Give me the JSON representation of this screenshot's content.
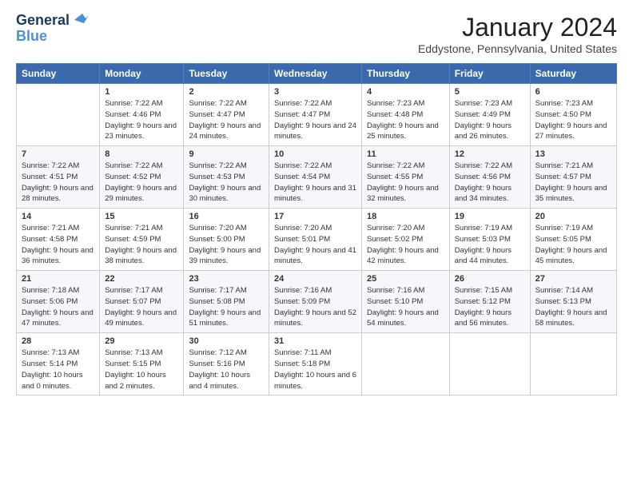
{
  "logo": {
    "line1": "General",
    "line2": "Blue"
  },
  "title": "January 2024",
  "subtitle": "Eddystone, Pennsylvania, United States",
  "headers": [
    "Sunday",
    "Monday",
    "Tuesday",
    "Wednesday",
    "Thursday",
    "Friday",
    "Saturday"
  ],
  "weeks": [
    [
      {
        "day": "",
        "sunrise": "",
        "sunset": "",
        "daylight": ""
      },
      {
        "day": "1",
        "sunrise": "Sunrise: 7:22 AM",
        "sunset": "Sunset: 4:46 PM",
        "daylight": "Daylight: 9 hours and 23 minutes."
      },
      {
        "day": "2",
        "sunrise": "Sunrise: 7:22 AM",
        "sunset": "Sunset: 4:47 PM",
        "daylight": "Daylight: 9 hours and 24 minutes."
      },
      {
        "day": "3",
        "sunrise": "Sunrise: 7:22 AM",
        "sunset": "Sunset: 4:47 PM",
        "daylight": "Daylight: 9 hours and 24 minutes."
      },
      {
        "day": "4",
        "sunrise": "Sunrise: 7:23 AM",
        "sunset": "Sunset: 4:48 PM",
        "daylight": "Daylight: 9 hours and 25 minutes."
      },
      {
        "day": "5",
        "sunrise": "Sunrise: 7:23 AM",
        "sunset": "Sunset: 4:49 PM",
        "daylight": "Daylight: 9 hours and 26 minutes."
      },
      {
        "day": "6",
        "sunrise": "Sunrise: 7:23 AM",
        "sunset": "Sunset: 4:50 PM",
        "daylight": "Daylight: 9 hours and 27 minutes."
      }
    ],
    [
      {
        "day": "7",
        "sunrise": "Sunrise: 7:22 AM",
        "sunset": "Sunset: 4:51 PM",
        "daylight": "Daylight: 9 hours and 28 minutes."
      },
      {
        "day": "8",
        "sunrise": "Sunrise: 7:22 AM",
        "sunset": "Sunset: 4:52 PM",
        "daylight": "Daylight: 9 hours and 29 minutes."
      },
      {
        "day": "9",
        "sunrise": "Sunrise: 7:22 AM",
        "sunset": "Sunset: 4:53 PM",
        "daylight": "Daylight: 9 hours and 30 minutes."
      },
      {
        "day": "10",
        "sunrise": "Sunrise: 7:22 AM",
        "sunset": "Sunset: 4:54 PM",
        "daylight": "Daylight: 9 hours and 31 minutes."
      },
      {
        "day": "11",
        "sunrise": "Sunrise: 7:22 AM",
        "sunset": "Sunset: 4:55 PM",
        "daylight": "Daylight: 9 hours and 32 minutes."
      },
      {
        "day": "12",
        "sunrise": "Sunrise: 7:22 AM",
        "sunset": "Sunset: 4:56 PM",
        "daylight": "Daylight: 9 hours and 34 minutes."
      },
      {
        "day": "13",
        "sunrise": "Sunrise: 7:21 AM",
        "sunset": "Sunset: 4:57 PM",
        "daylight": "Daylight: 9 hours and 35 minutes."
      }
    ],
    [
      {
        "day": "14",
        "sunrise": "Sunrise: 7:21 AM",
        "sunset": "Sunset: 4:58 PM",
        "daylight": "Daylight: 9 hours and 36 minutes."
      },
      {
        "day": "15",
        "sunrise": "Sunrise: 7:21 AM",
        "sunset": "Sunset: 4:59 PM",
        "daylight": "Daylight: 9 hours and 38 minutes."
      },
      {
        "day": "16",
        "sunrise": "Sunrise: 7:20 AM",
        "sunset": "Sunset: 5:00 PM",
        "daylight": "Daylight: 9 hours and 39 minutes."
      },
      {
        "day": "17",
        "sunrise": "Sunrise: 7:20 AM",
        "sunset": "Sunset: 5:01 PM",
        "daylight": "Daylight: 9 hours and 41 minutes."
      },
      {
        "day": "18",
        "sunrise": "Sunrise: 7:20 AM",
        "sunset": "Sunset: 5:02 PM",
        "daylight": "Daylight: 9 hours and 42 minutes."
      },
      {
        "day": "19",
        "sunrise": "Sunrise: 7:19 AM",
        "sunset": "Sunset: 5:03 PM",
        "daylight": "Daylight: 9 hours and 44 minutes."
      },
      {
        "day": "20",
        "sunrise": "Sunrise: 7:19 AM",
        "sunset": "Sunset: 5:05 PM",
        "daylight": "Daylight: 9 hours and 45 minutes."
      }
    ],
    [
      {
        "day": "21",
        "sunrise": "Sunrise: 7:18 AM",
        "sunset": "Sunset: 5:06 PM",
        "daylight": "Daylight: 9 hours and 47 minutes."
      },
      {
        "day": "22",
        "sunrise": "Sunrise: 7:17 AM",
        "sunset": "Sunset: 5:07 PM",
        "daylight": "Daylight: 9 hours and 49 minutes."
      },
      {
        "day": "23",
        "sunrise": "Sunrise: 7:17 AM",
        "sunset": "Sunset: 5:08 PM",
        "daylight": "Daylight: 9 hours and 51 minutes."
      },
      {
        "day": "24",
        "sunrise": "Sunrise: 7:16 AM",
        "sunset": "Sunset: 5:09 PM",
        "daylight": "Daylight: 9 hours and 52 minutes."
      },
      {
        "day": "25",
        "sunrise": "Sunrise: 7:16 AM",
        "sunset": "Sunset: 5:10 PM",
        "daylight": "Daylight: 9 hours and 54 minutes."
      },
      {
        "day": "26",
        "sunrise": "Sunrise: 7:15 AM",
        "sunset": "Sunset: 5:12 PM",
        "daylight": "Daylight: 9 hours and 56 minutes."
      },
      {
        "day": "27",
        "sunrise": "Sunrise: 7:14 AM",
        "sunset": "Sunset: 5:13 PM",
        "daylight": "Daylight: 9 hours and 58 minutes."
      }
    ],
    [
      {
        "day": "28",
        "sunrise": "Sunrise: 7:13 AM",
        "sunset": "Sunset: 5:14 PM",
        "daylight": "Daylight: 10 hours and 0 minutes."
      },
      {
        "day": "29",
        "sunrise": "Sunrise: 7:13 AM",
        "sunset": "Sunset: 5:15 PM",
        "daylight": "Daylight: 10 hours and 2 minutes."
      },
      {
        "day": "30",
        "sunrise": "Sunrise: 7:12 AM",
        "sunset": "Sunset: 5:16 PM",
        "daylight": "Daylight: 10 hours and 4 minutes."
      },
      {
        "day": "31",
        "sunrise": "Sunrise: 7:11 AM",
        "sunset": "Sunset: 5:18 PM",
        "daylight": "Daylight: 10 hours and 6 minutes."
      },
      {
        "day": "",
        "sunrise": "",
        "sunset": "",
        "daylight": ""
      },
      {
        "day": "",
        "sunrise": "",
        "sunset": "",
        "daylight": ""
      },
      {
        "day": "",
        "sunrise": "",
        "sunset": "",
        "daylight": ""
      }
    ]
  ]
}
